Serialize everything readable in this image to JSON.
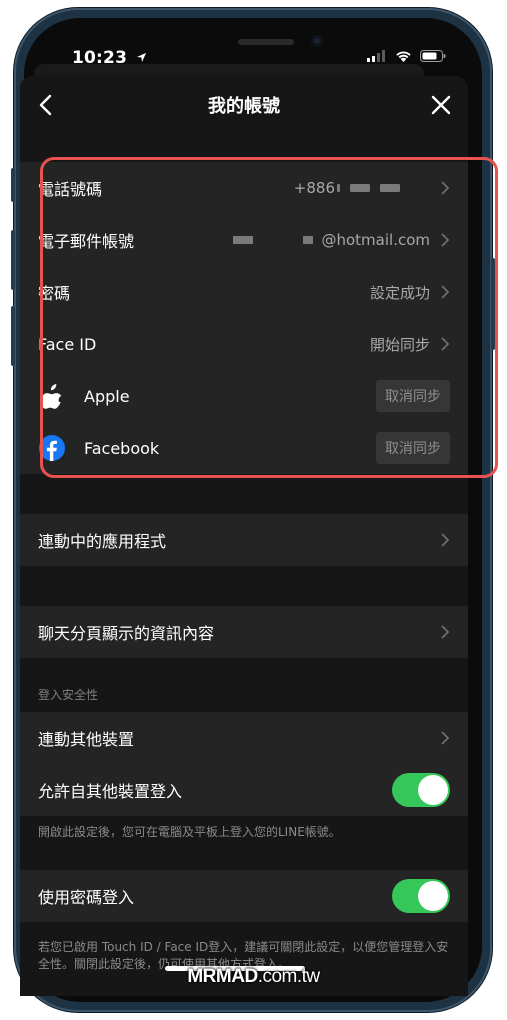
{
  "status_bar": {
    "time": "10:23"
  },
  "nav": {
    "title": "我的帳號"
  },
  "account": {
    "phone": {
      "label": "電話號碼",
      "value": "+886"
    },
    "email": {
      "label": "電子郵件帳號",
      "value": "@hotmail.com"
    },
    "password": {
      "label": "密碼",
      "value": "設定成功"
    },
    "face_id": {
      "label": "Face ID",
      "value": "開始同步"
    },
    "apple": {
      "label": "Apple",
      "button": "取消同步"
    },
    "facebook": {
      "label": "Facebook",
      "button": "取消同步"
    }
  },
  "linked_apps": {
    "label": "連動中的應用程式"
  },
  "chat_info": {
    "label": "聊天分頁顯示的資訊內容"
  },
  "login_security": {
    "header": "登入安全性",
    "link_devices": {
      "label": "連動其他裝置"
    },
    "allow_login": {
      "label": "允許自其他裝置登入",
      "enabled": true
    },
    "allow_login_note": "開啟此設定後，您可在電腦及平板上登入您的LINE帳號。",
    "password_login": {
      "label": "使用密碼登入",
      "enabled": true
    },
    "password_login_note": "若您已啟用 Touch ID / Face ID登入，建議可關閉此設定，以便您管理登入安全性。關閉此設定後，仍可使用其他方式登入。"
  },
  "watermark": {
    "brand": "MRMAD",
    "suffix": ".com.tw"
  },
  "colors": {
    "toggle_on": "#35c759",
    "highlight": "#e8534f",
    "facebook_blue": "#1877f2"
  }
}
